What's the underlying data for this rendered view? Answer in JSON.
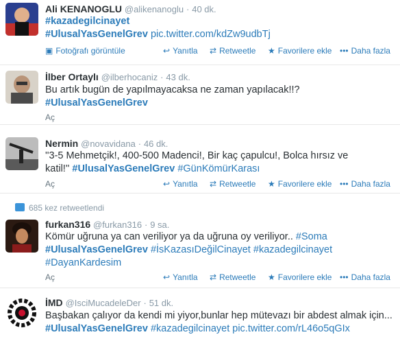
{
  "tweets": [
    {
      "fullname": "Ali KENANOGLU",
      "username": "@alikenanoglu",
      "time": "40 dk.",
      "lines": [
        [
          {
            "t": "#kazadegilcinayet",
            "k": "tag"
          }
        ],
        [
          {
            "t": "#UlusalYasGenelGrev",
            "k": "tag"
          },
          {
            "t": " ",
            "k": "plain"
          },
          {
            "t": "pic.twitter.com/kdZw9udbTj",
            "k": "link"
          }
        ]
      ],
      "expand_label": "Fotoğrafı görüntüle",
      "reply": "Yanıtla",
      "retweet": "Retweetle",
      "favorite": "Favorilere ekle",
      "more": "Daha fazla"
    },
    {
      "fullname": "İlber Ortaylı",
      "username": "@ilberhocaniz",
      "time": "43 dk.",
      "lines": [
        [
          {
            "t": "Bu artık bugün de yapılmayacaksa ne zaman yapılacak!!?",
            "k": "plain"
          }
        ],
        [
          {
            "t": "#UlusalYasGenelGrev",
            "k": "tag"
          }
        ]
      ],
      "expand_label": "Aç"
    },
    {
      "fullname": "Nermin",
      "username": "@novavidana",
      "time": "46 dk.",
      "lines": [
        [
          {
            "t": "''3-5 Mehmetçik!, 400-500 Madenci!, Bir kaç çapulcu!,  Bolca hırsız ve",
            "k": "plain"
          }
        ],
        [
          {
            "t": "katil!'' ",
            "k": "plain"
          },
          {
            "t": "#UlusalYasGenelGrev",
            "k": "tag"
          },
          {
            "t": " ",
            "k": "plain"
          },
          {
            "t": "#GünKömürKarası",
            "k": "link"
          }
        ]
      ],
      "expand_label": "Aç",
      "reply": "Yanıtla",
      "retweet": "Retweetle",
      "favorite": "Favorilere ekle",
      "more": "Daha fazla"
    },
    {
      "context": "685 kez retweetlendi",
      "fullname": "furkan316",
      "username": "@furkan316",
      "time": "9 sa.",
      "lines": [
        [
          {
            "t": "Kömür uğruna ya can veriliyor ya da uğruna oy veriliyor.. ",
            "k": "plain"
          },
          {
            "t": "#Soma",
            "k": "link"
          }
        ],
        [
          {
            "t": "#UlusalYasGenelGrev",
            "k": "tag"
          },
          {
            "t": " ",
            "k": "plain"
          },
          {
            "t": "#İsKazasıDeğilCinayet",
            "k": "link"
          },
          {
            "t": " ",
            "k": "plain"
          },
          {
            "t": "#kazadegilcinayet",
            "k": "link"
          }
        ],
        [
          {
            "t": "#DayanKardesim",
            "k": "link"
          }
        ]
      ],
      "expand_label": "Aç",
      "reply": "Yanıtla",
      "retweet": "Retweetle",
      "favorite": "Favorilere ekle",
      "more": "Daha fazla"
    },
    {
      "fullname": "İMD",
      "username": "@IsciMucadeleDer",
      "time": "51 dk.",
      "lines": [
        [
          {
            "t": "Başbakan çalıyor da kendi mi yiyor,bunlar hep mütevazı bir abdest almak için...",
            "k": "plain"
          }
        ],
        [
          {
            "t": "#UlusalYasGenelGrev",
            "k": "tag"
          },
          {
            "t": " ",
            "k": "plain"
          },
          {
            "t": "#kazadegilcinayet",
            "k": "link"
          },
          {
            "t": " ",
            "k": "plain"
          },
          {
            "t": "pic.twitter.com/rL46o5qGIx",
            "k": "link"
          }
        ]
      ]
    }
  ],
  "colors": {
    "link": "#2b7bb9",
    "muted": "#8899a6",
    "text": "#292f33"
  }
}
